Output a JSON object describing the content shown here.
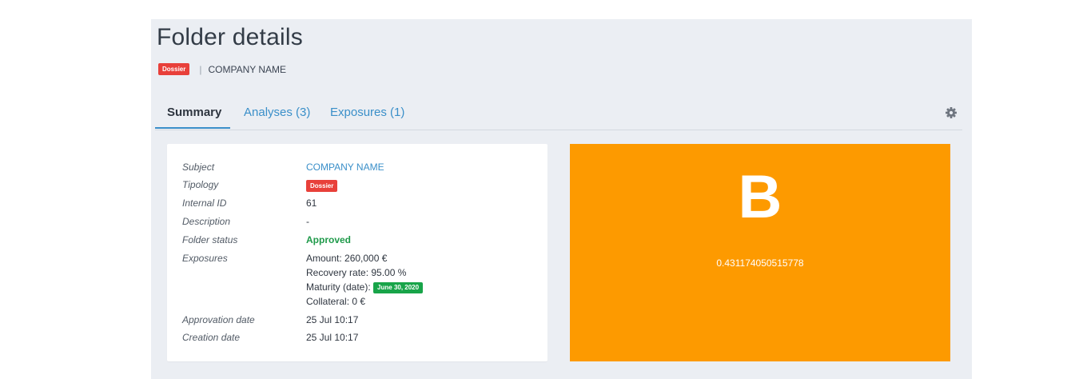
{
  "header": {
    "title": "Folder details",
    "badge": "Dossier",
    "separator": "|",
    "company": "COMPANY NAME"
  },
  "tabs": [
    {
      "label": "Summary",
      "active": true
    },
    {
      "label": "Analyses (3)",
      "active": false
    },
    {
      "label": "Exposures (1)",
      "active": false
    }
  ],
  "summary": {
    "subject": {
      "label": "Subject",
      "value": "COMPANY NAME"
    },
    "tipology": {
      "label": "Tipology",
      "value": "Dossier"
    },
    "internal_id": {
      "label": "Internal ID",
      "value": "61"
    },
    "description": {
      "label": "Description",
      "value": "-"
    },
    "folder_status": {
      "label": "Folder status",
      "value": "Approved"
    },
    "exposures": {
      "label": "Exposures",
      "amount": "Amount: 260,000 €",
      "recovery_rate": "Recovery rate: 95.00 %",
      "maturity_label": "Maturity (date):",
      "maturity_date": "June 30, 2020",
      "collateral": "Collateral: 0 €"
    },
    "approvation_date": {
      "label": "Approvation date",
      "value": "25 Jul 10:17"
    },
    "creation_date": {
      "label": "Creation date",
      "value": "25 Jul 10:17"
    }
  },
  "score": {
    "letter": "B",
    "value": "0.431174050515778",
    "color": "#fd9a00"
  },
  "icons": {
    "settings": "gear-icon"
  },
  "colors": {
    "accent": "#3a8fc9",
    "badge_red": "#e8403a",
    "approved_green": "#1f9a4a",
    "panel_bg": "#ebeef3"
  }
}
